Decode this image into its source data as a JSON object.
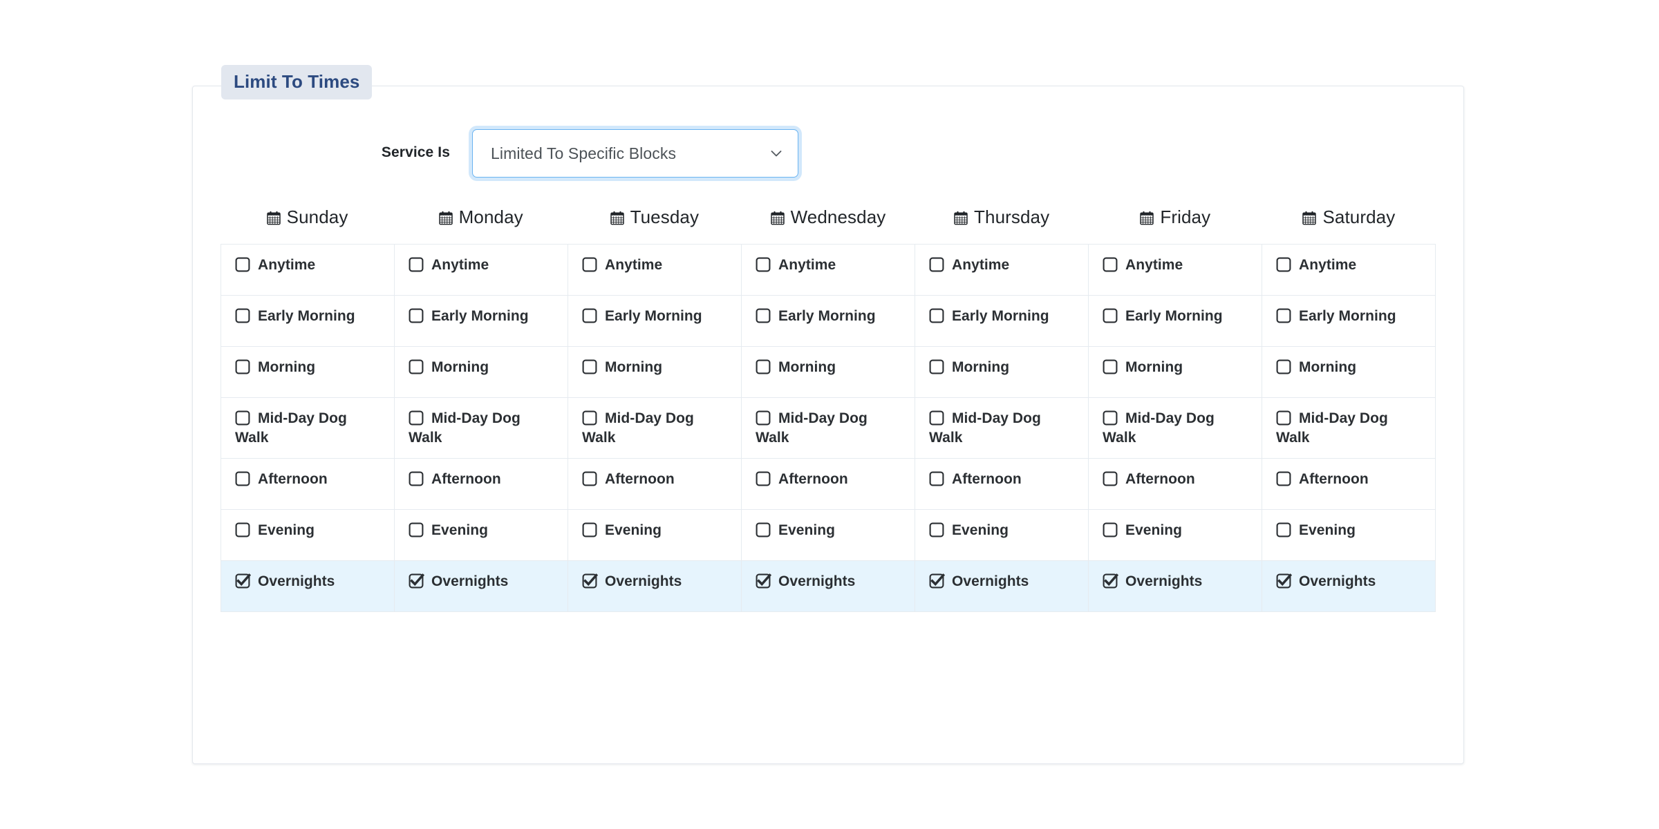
{
  "panel": {
    "legend": "Limit To Times"
  },
  "service": {
    "label": "Service Is",
    "selected": "Limited To Specific Blocks",
    "options": [
      "Limited To Specific Blocks"
    ],
    "chevron_icon": "chevron-down-icon",
    "focus_color": "#6ab3f1"
  },
  "days": [
    {
      "name": "Sunday",
      "icon": "calendar-icon"
    },
    {
      "name": "Monday",
      "icon": "calendar-icon"
    },
    {
      "name": "Tuesday",
      "icon": "calendar-icon"
    },
    {
      "name": "Wednesday",
      "icon": "calendar-icon"
    },
    {
      "name": "Thursday",
      "icon": "calendar-icon"
    },
    {
      "name": "Friday",
      "icon": "calendar-icon"
    },
    {
      "name": "Saturday",
      "icon": "calendar-icon"
    }
  ],
  "blocks": [
    {
      "label": "Anytime",
      "checked": false
    },
    {
      "label": "Early Morning",
      "checked": false
    },
    {
      "label": "Morning",
      "checked": false
    },
    {
      "label": "Mid-Day Dog Walk",
      "checked": false
    },
    {
      "label": "Afternoon",
      "checked": false
    },
    {
      "label": "Evening",
      "checked": false
    },
    {
      "label": "Overnights",
      "checked": true
    }
  ],
  "colors": {
    "legend_bg": "#e2e7ef",
    "legend_text": "#2c4a80",
    "checked_row_bg": "#e6f4fd",
    "grid_border": "#e6ebf0",
    "panel_border": "#e4e8ed",
    "label_text": "#2b2f33"
  }
}
